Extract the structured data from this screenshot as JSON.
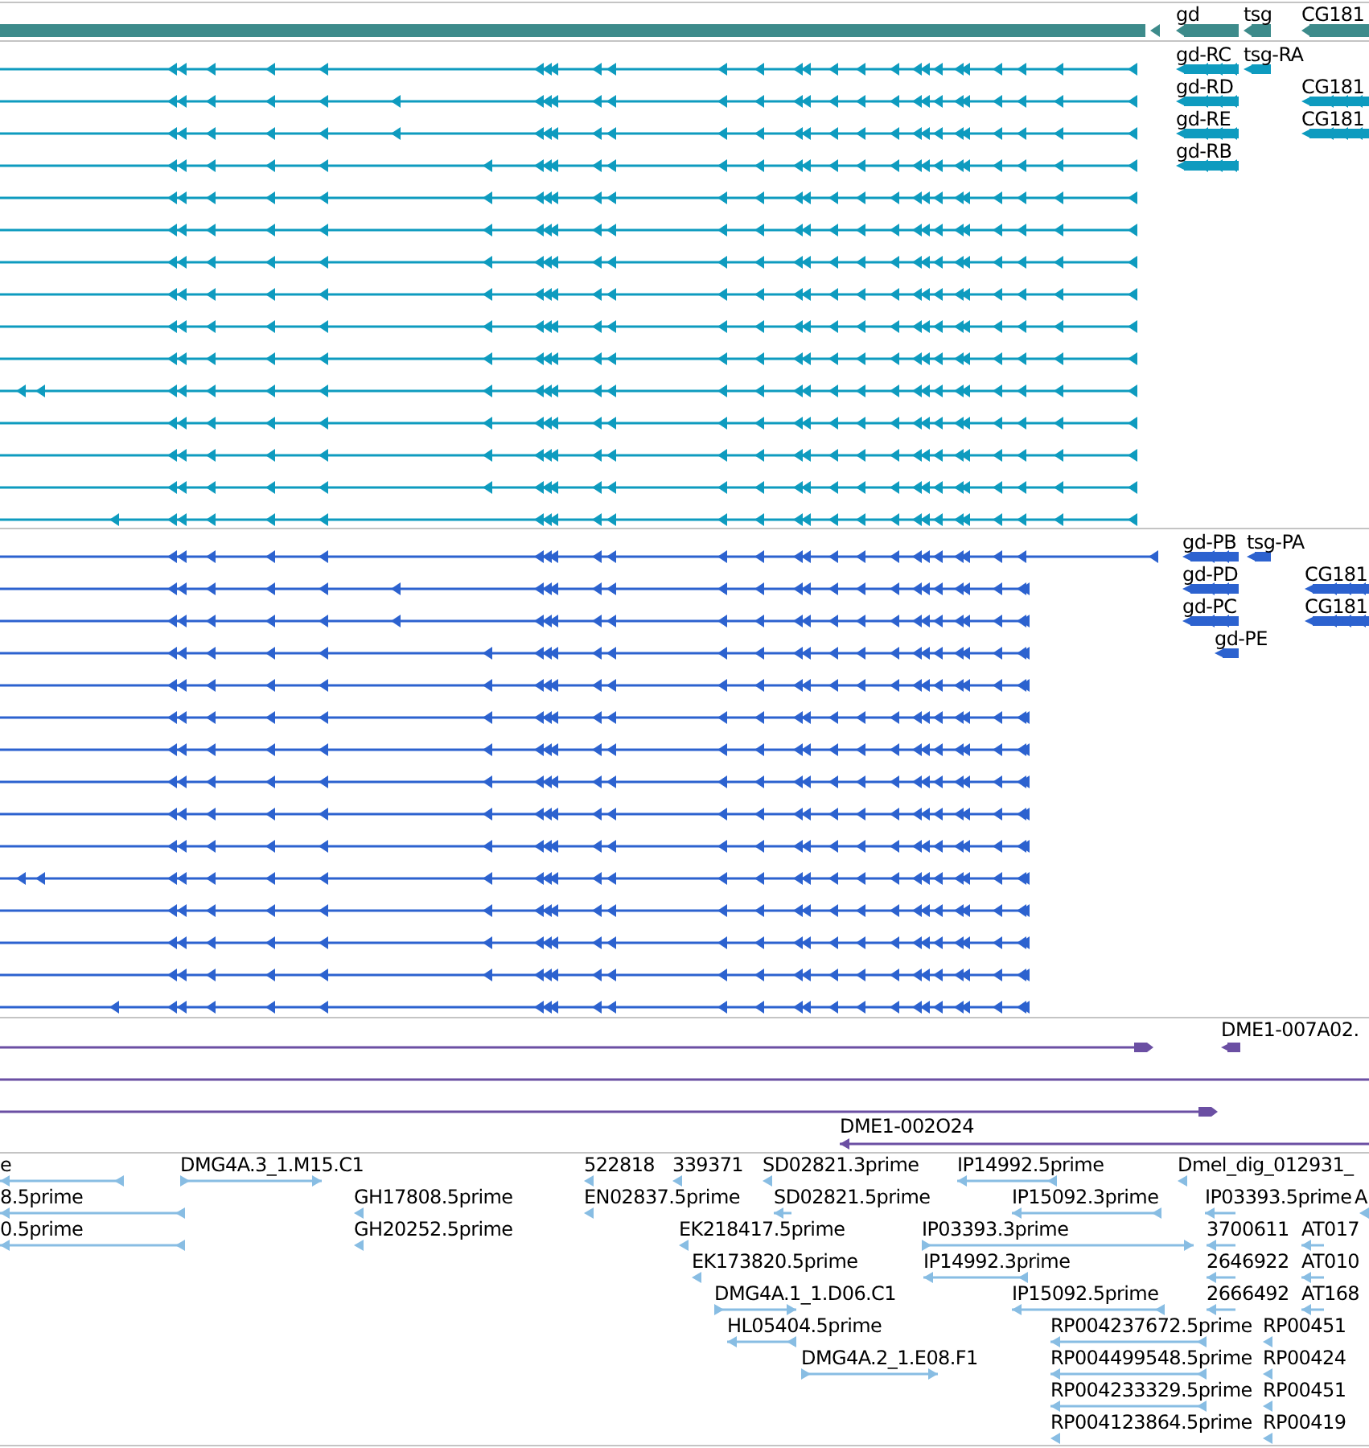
{
  "tracks": [
    {
      "kind": "genes",
      "color": "#3d8b8b",
      "labels": [
        "gd",
        "tsg",
        "CG181"
      ]
    },
    {
      "kind": "transcripts",
      "color": "#0e9bbf",
      "labels": [
        "gd-RC",
        "tsg-RA",
        "gd-RD",
        "CG181",
        "gd-RE",
        "CG181",
        "gd-RB"
      ]
    },
    {
      "kind": "transcripts",
      "color": "#2c62cf",
      "labels": [
        "gd-PB",
        "tsg-PA",
        "gd-PD",
        "CG181",
        "gd-PC",
        "CG181",
        "gd-PE"
      ]
    },
    {
      "kind": "alignments",
      "color": "#6b4fa3",
      "labels": [
        "DME1-007A02.",
        "DME1-002O24"
      ]
    },
    {
      "kind": "ests",
      "color": "#88bde3",
      "labels": [
        "e",
        "DMG4A.3_1.M15.C1",
        "522818",
        "339371",
        "SD02821.3prime",
        "IP14992.5prime",
        "Dmel_dig_012931_",
        "8.5prime",
        "GH17808.5prime",
        "EN02837.5prime",
        "SD02821.5prime",
        "IP15092.3prime",
        "IP03393.5prime",
        "A",
        "0.5prime",
        "GH20252.5prime",
        "EK218417.5prime",
        "IP03393.3prime",
        "3700611",
        "AT017",
        "EK173820.5prime",
        "IP14992.3prime",
        "2646922",
        "AT010",
        "DMG4A.1_1.D06.C1",
        "IP15092.5prime",
        "2666492",
        "AT168",
        "HL05404.5prime",
        "RP004237672.5prime",
        "RP00451",
        "DMG4A.2_1.E08.F1",
        "RP004499548.5prime",
        "RP00424",
        "RP004233329.5prime",
        "RP00451",
        "RP004123864.5prime",
        "RP00419"
      ]
    }
  ]
}
